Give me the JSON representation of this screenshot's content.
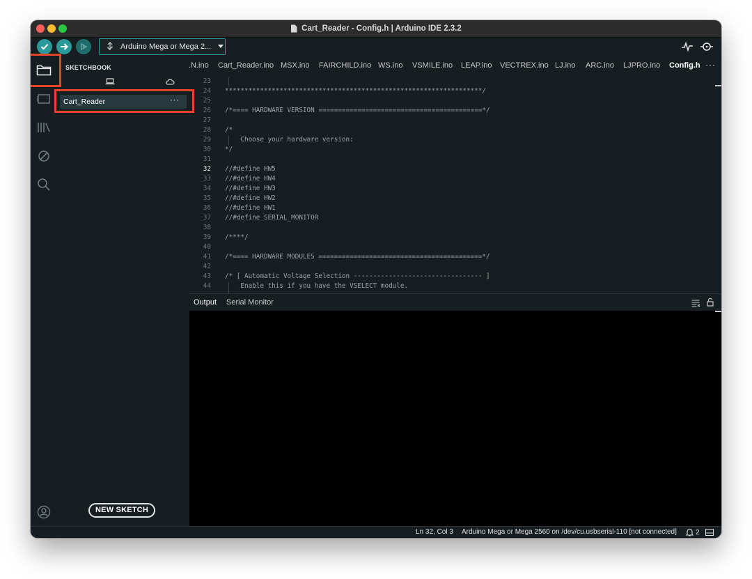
{
  "window": {
    "title": "Cart_Reader - Config.h | Arduino IDE 2.3.2"
  },
  "toolbar": {
    "verify_icon": "check-icon",
    "upload_icon": "arrow-right-icon",
    "debug_icon": "debug-icon",
    "board_label": "Arduino Mega or Mega 2...",
    "serial_plotter_icon": "pulse-icon",
    "serial_monitor_icon": "magnifier-icon"
  },
  "sidebar": {
    "title": "SKETCHBOOK",
    "local_icon": "laptop-icon",
    "cloud_icon": "cloud-icon",
    "sketch_name": "Cart_Reader",
    "sketch_more": "···",
    "new_sketch": "NEW SKETCH"
  },
  "tabs": [
    {
      "label": ".N.ino"
    },
    {
      "label": "Cart_Reader.ino"
    },
    {
      "label": "MSX.ino"
    },
    {
      "label": "FAIRCHILD.ino"
    },
    {
      "label": "WS.ino"
    },
    {
      "label": "VSMILE.ino"
    },
    {
      "label": "LEAP.ino"
    },
    {
      "label": "VECTREX.ino"
    },
    {
      "label": "LJ.ino"
    },
    {
      "label": "ARC.ino"
    },
    {
      "label": "LJPRO.ino"
    },
    {
      "label": "Config.h",
      "active": true
    }
  ],
  "tabs_more": "···",
  "editor": {
    "lines": [
      {
        "n": "23",
        "t": ""
      },
      {
        "n": "24",
        "t": "******************************************************************/"
      },
      {
        "n": "25",
        "t": ""
      },
      {
        "n": "26",
        "t": "/*==== HARDWARE VERSION ==========================================*/"
      },
      {
        "n": "27",
        "t": ""
      },
      {
        "n": "28",
        "t": "/*"
      },
      {
        "n": "29",
        "t": "    Choose your hardware version:"
      },
      {
        "n": "30",
        "t": "*/"
      },
      {
        "n": "31",
        "t": ""
      },
      {
        "n": "32",
        "t": "//#define HW5"
      },
      {
        "n": "33",
        "t": "//#define HW4"
      },
      {
        "n": "34",
        "t": "//#define HW3"
      },
      {
        "n": "35",
        "t": "//#define HW2"
      },
      {
        "n": "36",
        "t": "//#define HW1"
      },
      {
        "n": "37",
        "t": "//#define SERIAL_MONITOR"
      },
      {
        "n": "38",
        "t": ""
      },
      {
        "n": "39",
        "t": "/****/"
      },
      {
        "n": "40",
        "t": ""
      },
      {
        "n": "41",
        "t": "/*==== HARDWARE MODULES ==========================================*/"
      },
      {
        "n": "42",
        "t": ""
      },
      {
        "n": "43",
        "t": "/* [ Automatic Voltage Selection --------------------------------- ]"
      },
      {
        "n": "44",
        "t": "    Enable this if you have the VSELECT module."
      }
    ],
    "active_line": "32"
  },
  "panel": {
    "output_tab": "Output",
    "serial_tab": "Serial Monitor",
    "clear_icon": "clear-output-icon",
    "lock_icon": "lock-icon"
  },
  "status": {
    "position": "Ln 32, Col 3",
    "board": "Arduino Mega or Mega 2560 on /dev/cu.usbserial-110 [not connected]",
    "notifications": "2",
    "notification_icon": "bell-icon",
    "panel_icon": "panel-toggle-icon"
  },
  "colors": {
    "accent": "#2a9a9a",
    "highlight": "#e8432b",
    "background": "#171e21"
  }
}
